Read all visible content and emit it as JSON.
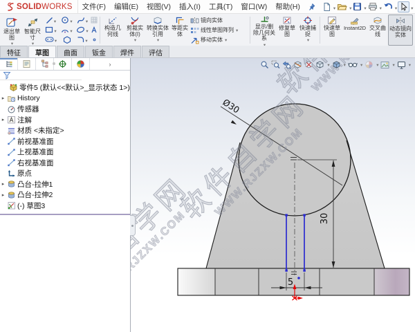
{
  "menu": {
    "logo_bold": "SOLID",
    "logo_light": "WORKS",
    "items": [
      "文件(F)",
      "编辑(E)",
      "视图(V)",
      "插入(I)",
      "工具(T)",
      "窗口(W)",
      "帮助(H)"
    ]
  },
  "quick_access": {
    "buttons": [
      "new-file",
      "open-file",
      "save",
      "print",
      "undo",
      "select",
      "rebuild",
      "options-list",
      "settings"
    ]
  },
  "command_manager": {
    "exit_sketch": "退出草图",
    "smart_dimension": "智能尺寸",
    "construction_geometry": "构造几何线",
    "trim_entities": "剪裁实体(I)",
    "convert_entities": "转换实体引用",
    "offset_entities": "等距实体",
    "mirror_entities": "镜向实体",
    "linear_sketch_pattern": "线性草图阵列",
    "move_entities": "移动实体",
    "display_delete_relations": "显示/删除几何关系",
    "repair_sketch": "修复草图",
    "quick_snaps": "快速捕捉",
    "rapid_sketch": "快速草图",
    "instant2d": "Instant2D",
    "intersection_curve": "交叉曲线",
    "dynamic_mirror": "动态镜向实体"
  },
  "tabs": [
    {
      "label": "特征",
      "active": false
    },
    {
      "label": "草图",
      "active": true
    },
    {
      "label": "曲面",
      "active": false
    },
    {
      "label": "钣金",
      "active": false
    },
    {
      "label": "焊件",
      "active": false
    },
    {
      "label": "评估",
      "active": false
    }
  ],
  "feature_tree": {
    "root": "零件5 (默认<<默认>_显示状态 1>)",
    "items": [
      {
        "label": "History",
        "expandable": true
      },
      {
        "label": "传感器",
        "expandable": false
      },
      {
        "label": "注解",
        "expandable": true
      },
      {
        "label": "材质 <未指定>",
        "expandable": false
      },
      {
        "label": "前视基准面",
        "expandable": false
      },
      {
        "label": "上视基准面",
        "expandable": false
      },
      {
        "label": "右视基准面",
        "expandable": false
      },
      {
        "label": "原点",
        "expandable": false
      },
      {
        "label": "凸台-拉伸1",
        "expandable": true
      },
      {
        "label": "凸台-拉伸2",
        "expandable": true
      },
      {
        "label": "(-) 草图3",
        "expandable": false
      }
    ]
  },
  "viewport": {
    "dimensions": {
      "diameter": "Ø30",
      "height": "30",
      "width": "5"
    },
    "watermark": {
      "line1": "软件自学网",
      "line2": "WWW.RJZXW.COM"
    },
    "colors": {
      "sketch_line": "#2a2ad0",
      "origin_marker": "#e60000",
      "model_fill": "#c9c9c9",
      "base_right_fill": "#b9a8bb"
    }
  }
}
